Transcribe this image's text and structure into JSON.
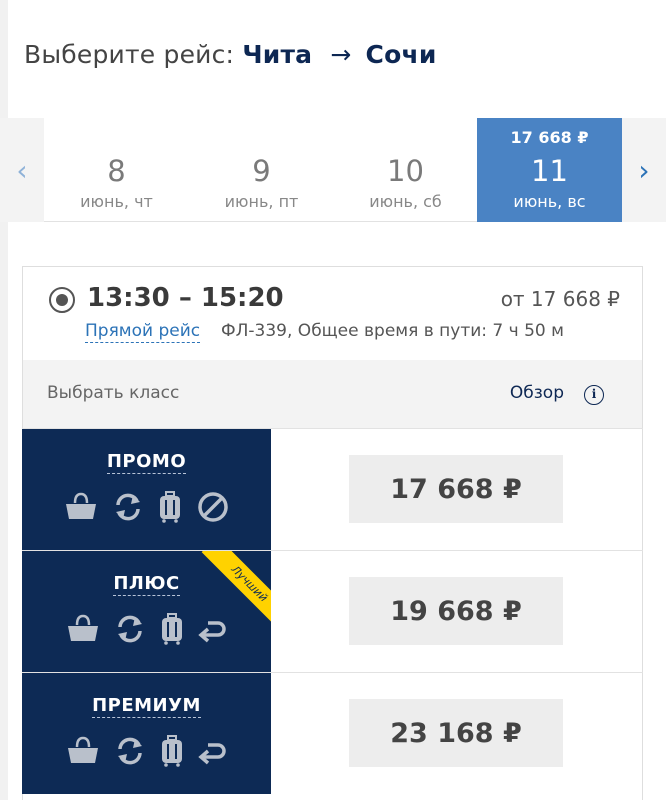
{
  "header": {
    "title_prefix": "Выберите рейс:",
    "origin": "Чита",
    "arrow": "→",
    "destination": "Сочи"
  },
  "date_strip": {
    "prev_arrow": "‹",
    "next_arrow": "›",
    "dates": [
      {
        "day": "8",
        "weekday": "июнь, чт",
        "price": ""
      },
      {
        "day": "9",
        "weekday": "июнь, пт",
        "price": ""
      },
      {
        "day": "10",
        "weekday": "июнь, сб",
        "price": ""
      },
      {
        "day": "11",
        "weekday": "июнь, вс",
        "price": "17 668 ₽",
        "selected": true
      }
    ]
  },
  "flight": {
    "time": "13:30 – 15:20",
    "from_price": "от 17 668 ₽",
    "direct_label": "Прямой рейс",
    "info": "ФЛ-339, Общее время в пути: 7 ч 50 м"
  },
  "class_bar": {
    "label": "Выбрать класс",
    "overview": "Обзор",
    "info_glyph": "i"
  },
  "fares": [
    {
      "name": "ПРОМО",
      "price": "17 668 ₽",
      "icons": [
        "handbag-icon",
        "exchange-icon",
        "luggage-icon",
        "no-refund-icon"
      ]
    },
    {
      "name": "ПЛЮС",
      "price": "19 668 ₽",
      "badge": "Лучший",
      "icons": [
        "handbag-icon",
        "exchange-icon",
        "luggage-icon",
        "refund-icon"
      ]
    },
    {
      "name": "ПРЕМИУМ",
      "price": "23 168 ₽",
      "icons": [
        "handbag-icon",
        "exchange-icon",
        "luggage-icon",
        "refund-icon"
      ]
    }
  ],
  "colors": {
    "navy": "#0d2a55",
    "accent_blue": "#4a83c4",
    "link_blue": "#2c73b7",
    "badge_yellow": "#ffd200",
    "icon_grey": "#b9c0cb"
  }
}
